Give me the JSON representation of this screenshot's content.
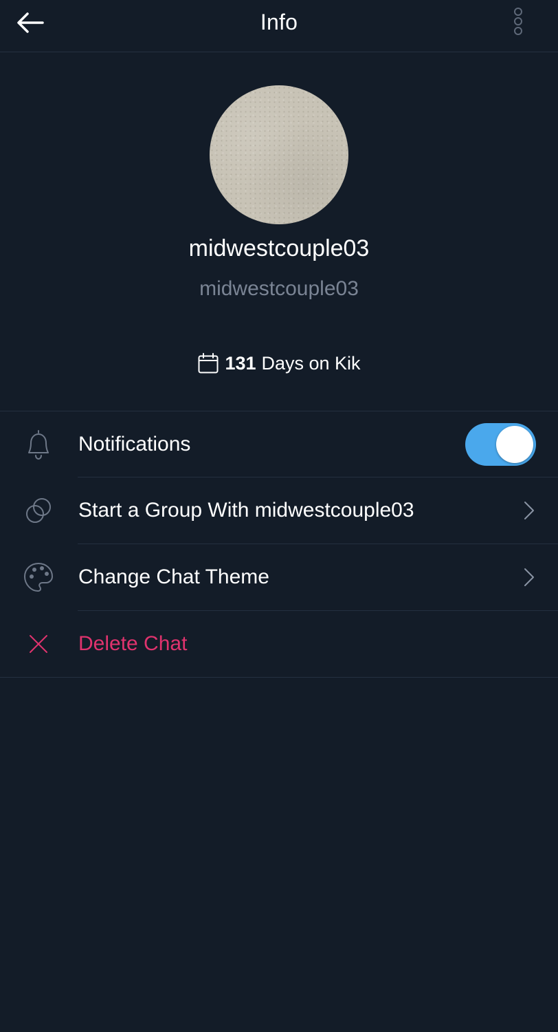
{
  "header": {
    "title": "Info",
    "back_icon": "arrow-left-icon",
    "more_icon": "vertical-dots-icon"
  },
  "profile": {
    "avatar_color": "#c8c3b6",
    "display_name": "midwestcouple03",
    "username": "midwestcouple03",
    "days_icon": "calendar-icon",
    "days_count": "131",
    "days_suffix": "Days on Kik"
  },
  "settings": {
    "notifications": {
      "label": "Notifications",
      "icon": "bell-icon",
      "enabled": true,
      "toggle_color": "#4aa8ec"
    },
    "start_group": {
      "label": "Start a Group With midwestcouple03",
      "icon": "overlapping-circles-icon"
    },
    "change_theme": {
      "label": "Change Chat Theme",
      "icon": "palette-icon"
    },
    "delete_chat": {
      "label": "Delete Chat",
      "icon": "close-x-icon",
      "color": "#e0336e"
    }
  }
}
